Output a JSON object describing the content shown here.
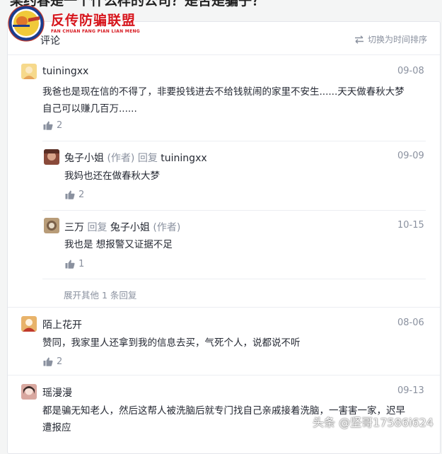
{
  "page": {
    "title": "某约春是一个什么样的公司？是否是骗子？"
  },
  "logo": {
    "name_cn": "反传防骗联盟",
    "name_pinyin": "FAN CHUAN FANG PIAN LIAN MENG"
  },
  "comments_header": {
    "label": "评论",
    "sort_label": "切换为时间排序",
    "sort_icon": "swap-arrows-icon"
  },
  "comments": [
    {
      "author": "tuiningxx",
      "date": "09-08",
      "text_line1": "我爸也是现在信的不得了，非要投钱进去不给钱就闹的家里不安生......天天做春秋大梦",
      "text_line2": "自己可以赚几百万......",
      "likes": "2",
      "avatar_color": "#f6d98c",
      "replies": [
        {
          "author": "兔子小姐",
          "author_tag": "(作者)",
          "reply_word": "回复",
          "reply_to": "tuiningxx",
          "date": "09-09",
          "text": "我妈也还在做春秋大梦",
          "likes": "2",
          "avatar_color": "#8a4a3a"
        },
        {
          "author": "三万",
          "reply_word": "回复",
          "reply_to": "兔子小姐",
          "reply_to_tag": "(作者)",
          "date": "10-15",
          "text": "我也是 想报警又证据不足",
          "likes": "1",
          "avatar_color": "#b89c78"
        }
      ],
      "expand_label": "展开其他 1 条回复"
    },
    {
      "author": "陌上花开",
      "date": "08-06",
      "text_line1": "赞同，我家里人还拿到我的信息去买，气死个人，说都说不听",
      "likes": "2",
      "avatar_color": "#e8b36a"
    },
    {
      "author": "瑶漫漫",
      "date": "09-13",
      "text_line1": "都是骗无知老人，然后这帮人被洗脑后就专门找自己亲戚接着洗脑，一害害一家，迟早",
      "text_line2": "遭报应",
      "avatar_color": "#d9a8a0"
    }
  ],
  "watermark": "头条 @坚哥17586i624"
}
